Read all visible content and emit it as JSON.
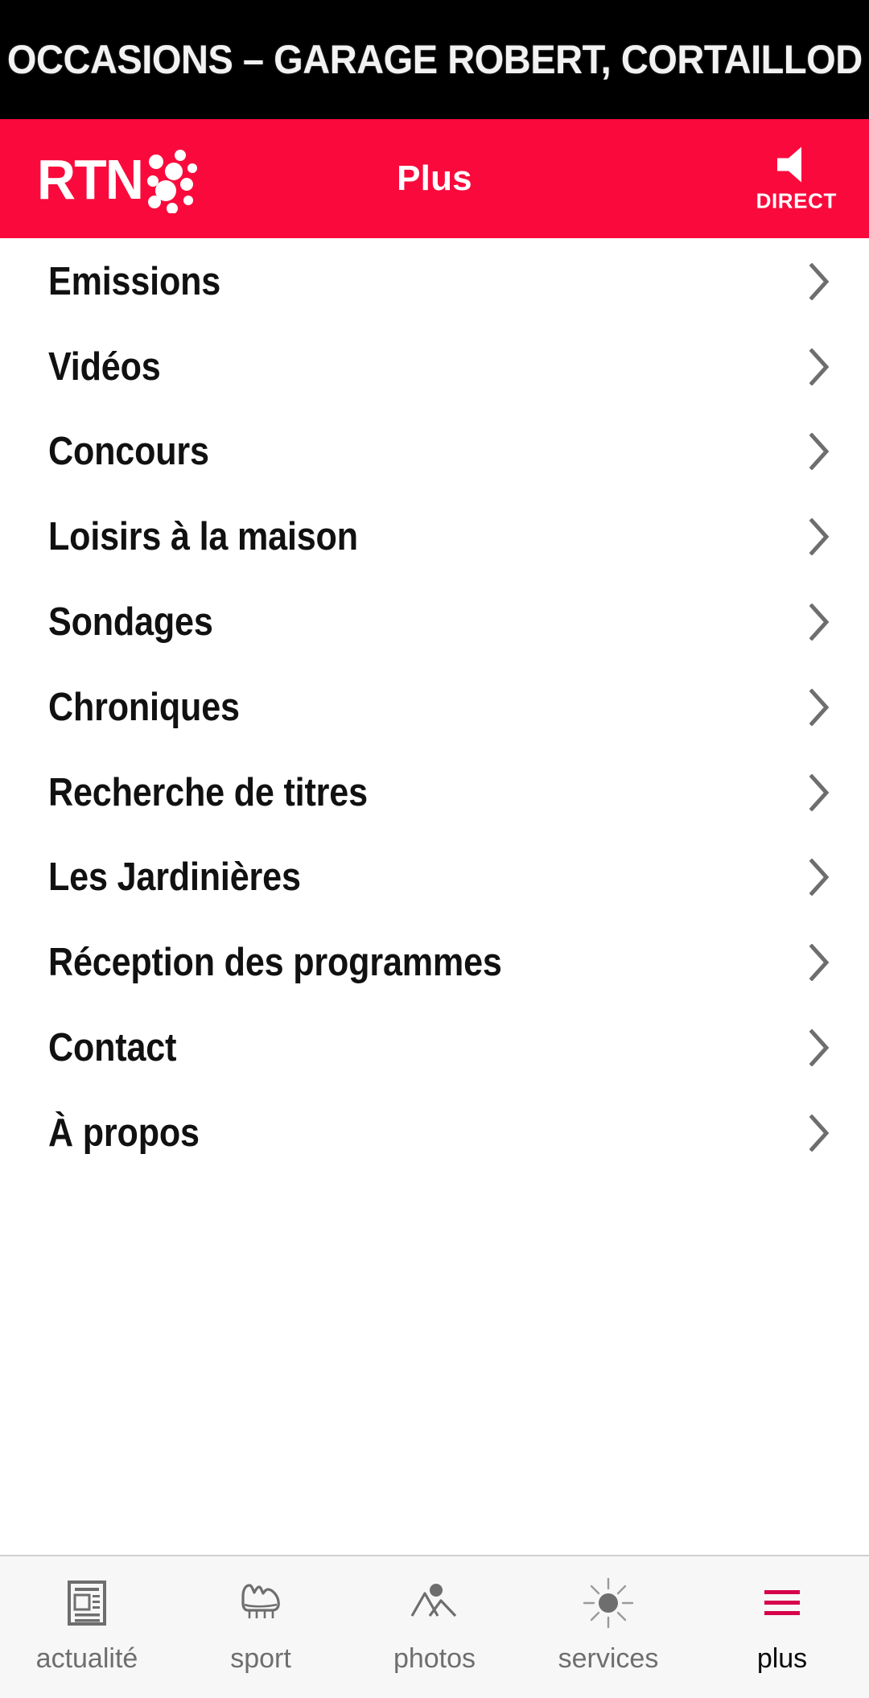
{
  "ad": {
    "text": "OCCASIONS – GARAGE ROBERT, CORTAILLOD"
  },
  "header": {
    "logo_text": "RTN",
    "title": "Plus",
    "direct_label": "DIRECT",
    "background_color": "#fa0a3c",
    "text_color": "#ffffff",
    "speaker_icon": "speaker-icon"
  },
  "menu": {
    "items": [
      {
        "label": "Emissions",
        "chevron": "chevron-right-icon"
      },
      {
        "label": "Vidéos",
        "chevron": "chevron-right-icon"
      },
      {
        "label": "Concours",
        "chevron": "chevron-right-icon"
      },
      {
        "label": "Loisirs à la maison",
        "chevron": "chevron-right-icon"
      },
      {
        "label": "Sondages",
        "chevron": "chevron-right-icon"
      },
      {
        "label": "Chroniques",
        "chevron": "chevron-right-icon"
      },
      {
        "label": "Recherche de titres",
        "chevron": "chevron-right-icon"
      },
      {
        "label": "Les Jardinières",
        "chevron": "chevron-right-icon"
      },
      {
        "label": "Réception des programmes",
        "chevron": "chevron-right-icon"
      },
      {
        "label": "Contact",
        "chevron": "chevron-right-icon"
      },
      {
        "label": "À propos",
        "chevron": "chevron-right-icon"
      }
    ]
  },
  "tabbar": {
    "active": "plus",
    "accent_color": "#d6004b",
    "inactive_color": "#6e6e6e",
    "items": [
      {
        "label": "actualité",
        "icon": "newspaper-icon",
        "active": false
      },
      {
        "label": "sport",
        "icon": "football-boot-icon",
        "active": false
      },
      {
        "label": "photos",
        "icon": "mountains-icon",
        "active": false
      },
      {
        "label": "services",
        "icon": "sun-icon",
        "active": false
      },
      {
        "label": "plus",
        "icon": "hamburger-icon",
        "active": true
      }
    ]
  }
}
